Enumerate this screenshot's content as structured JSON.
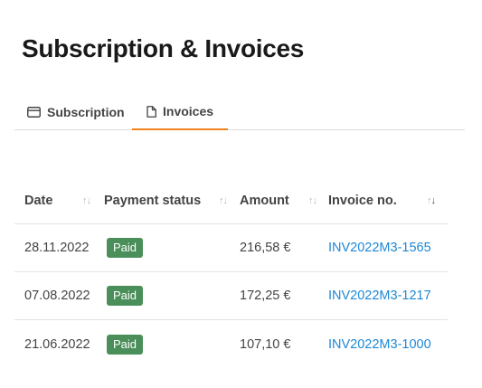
{
  "page": {
    "title": "Subscription & Invoices"
  },
  "tabs": [
    {
      "label": "Subscription",
      "icon": "credit-card-icon",
      "active": false
    },
    {
      "label": "Invoices",
      "icon": "document-icon",
      "active": true
    }
  ],
  "colors": {
    "accent": "#f0821e",
    "paid_badge": "#4a8f5a",
    "link": "#1e88d4"
  },
  "table": {
    "headers": {
      "date": "Date",
      "payment_status": "Payment status",
      "amount": "Amount",
      "invoice_no": "Invoice no."
    },
    "rows": [
      {
        "date": "28.11.2022",
        "status": "Paid",
        "amount": "216,58 €",
        "invoice_no": "INV2022M3-1565"
      },
      {
        "date": "07.08.2022",
        "status": "Paid",
        "amount": "172,25 €",
        "invoice_no": "INV2022M3-1217"
      },
      {
        "date": "21.06.2022",
        "status": "Paid",
        "amount": "107,10 €",
        "invoice_no": "INV2022M3-1000"
      }
    ]
  }
}
